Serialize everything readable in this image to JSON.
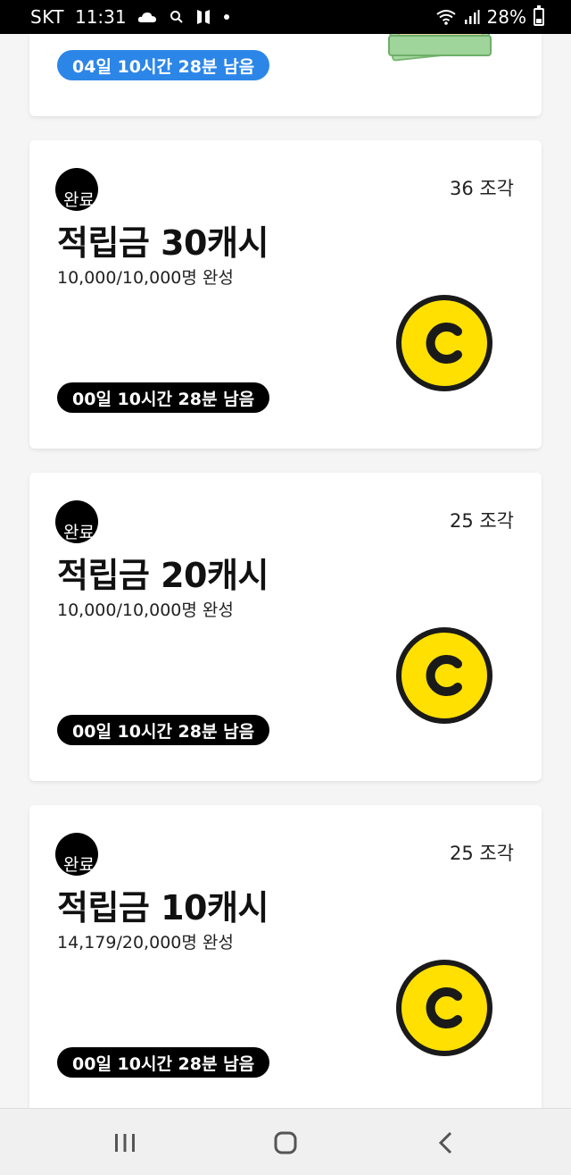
{
  "status_bar": {
    "carrier": "SKT",
    "time": "11:31",
    "battery": "28%",
    "icons": [
      "cloud-icon",
      "search-icon",
      "bts-icon",
      "dot-icon",
      "wifi-icon",
      "signal-icon",
      "battery-icon"
    ]
  },
  "top_card": {
    "timer": "04일 10시간 28분 남음",
    "illustration": "money-bills-icon"
  },
  "cards": [
    {
      "done_badge": "완료",
      "pieces": "36 조각",
      "title": "적립금 30캐시",
      "progress": "10,000/10,000명 완성",
      "timer": "00일 10시간 28분 남음",
      "icon": "cash-coin-icon"
    },
    {
      "done_badge": "완료",
      "pieces": "25 조각",
      "title": "적립금 20캐시",
      "progress": "10,000/10,000명 완성",
      "timer": "00일 10시간 28분 남음",
      "icon": "cash-coin-icon"
    },
    {
      "done_badge": "완료",
      "pieces": "25 조각",
      "title": "적립금 10캐시",
      "progress": "14,179/20,000명 완성",
      "timer": "00일 10시간 28분 남음",
      "icon": "cash-coin-icon"
    }
  ],
  "colors": {
    "timer_active": "#2c86e8",
    "timer_dark": "#000000",
    "coin_yellow": "#ffe000",
    "coin_outline": "#1a1a1a"
  },
  "nav_bar": {
    "buttons": [
      "recent-apps-icon",
      "home-icon",
      "back-icon"
    ]
  }
}
